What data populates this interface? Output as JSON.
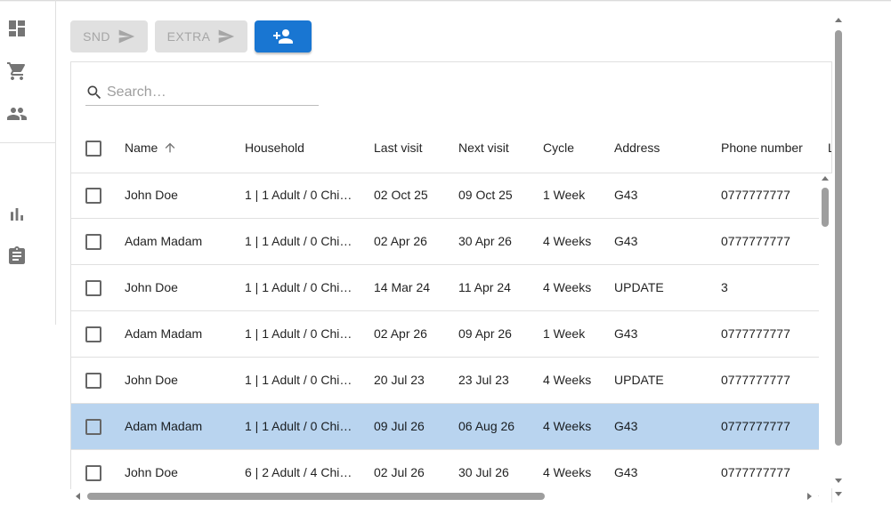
{
  "nav": {
    "items": [
      {
        "icon": "dashboard-icon"
      },
      {
        "icon": "cart-icon"
      },
      {
        "icon": "people-icon"
      },
      {
        "icon": "bar-chart-icon"
      },
      {
        "icon": "clipboard-icon"
      }
    ]
  },
  "toolbar": {
    "snd_label": "SND",
    "extra_label": "EXTRA",
    "add_icon": "person-add-icon",
    "primary_color": "#1976d2"
  },
  "search": {
    "placeholder": "Search…"
  },
  "table": {
    "columns": [
      "Name",
      "Household",
      "Last visit",
      "Next visit",
      "Cycle",
      "Address",
      "Phone number",
      "L"
    ],
    "sorted_column": "Name",
    "sort_direction": "ascending",
    "rows": [
      {
        "name": "John Doe",
        "household": "1 | 1 Adult / 0 Chi…",
        "last_visit": "02 Oct 25",
        "next_visit": "09 Oct 25",
        "cycle": "1 Week",
        "address": "G43",
        "phone": "0777777777",
        "selected": false
      },
      {
        "name": "Adam Madam",
        "household": "1 | 1 Adult / 0 Chi…",
        "last_visit": "02 Apr 26",
        "next_visit": "30 Apr 26",
        "cycle": "4 Weeks",
        "address": "G43",
        "phone": "0777777777",
        "selected": false
      },
      {
        "name": "John Doe",
        "household": "1 | 1 Adult / 0 Chi…",
        "last_visit": "14 Mar 24",
        "next_visit": "11 Apr 24",
        "cycle": "4 Weeks",
        "address": "UPDATE",
        "phone": "3",
        "selected": false
      },
      {
        "name": "Adam Madam",
        "household": "1 | 1 Adult / 0 Chi…",
        "last_visit": "02 Apr 26",
        "next_visit": "09 Apr 26",
        "cycle": "1 Week",
        "address": "G43",
        "phone": "0777777777",
        "selected": false
      },
      {
        "name": "John Doe",
        "household": "1 | 1 Adult / 0 Chi…",
        "last_visit": "20 Jul 23",
        "next_visit": "23 Jul 23",
        "cycle": "4 Weeks",
        "address": "UPDATE",
        "phone": "0777777777",
        "selected": false
      },
      {
        "name": "Adam Madam",
        "household": "1 | 1 Adult / 0 Chi…",
        "last_visit": "09 Jul 26",
        "next_visit": "06 Aug 26",
        "cycle": "4 Weeks",
        "address": "G43",
        "phone": "0777777777",
        "selected": true
      },
      {
        "name": "John Doe",
        "household": "6 | 2 Adult / 4 Chi…",
        "last_visit": "02 Jul 26",
        "next_visit": "30 Jul 26",
        "cycle": "4 Weeks",
        "address": "G43",
        "phone": "0777777777",
        "selected": false
      }
    ]
  },
  "colors": {
    "selected_row": "#b9d4ef"
  }
}
